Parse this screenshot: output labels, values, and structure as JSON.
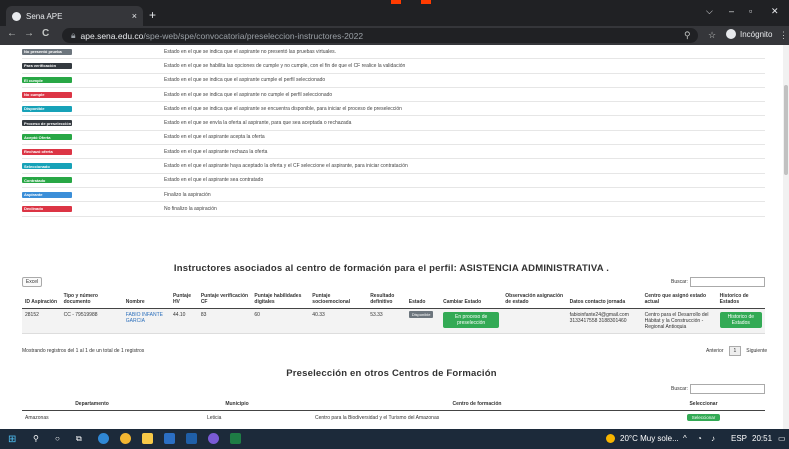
{
  "browser": {
    "tab_title": "Sena APE",
    "tab_close": "×",
    "new_tab": "+",
    "window_controls": {
      "minimize": "⌵",
      "min": "–",
      "max": "▫",
      "close": "✕"
    },
    "nav": {
      "back": "←",
      "forward": "→",
      "reload": "C"
    },
    "url_host": "ape.sena.edu.co",
    "url_path": "/spe-web/spe/convocatoria/preseleccion-instructores-2022",
    "profile_label": "Incógnito"
  },
  "legend": [
    {
      "badge": "No presentó prueba",
      "color": "#6c757d",
      "desc": "Estado en el que se indica que el aspirante no presentó las pruebas virtuales."
    },
    {
      "badge": "Para verificación",
      "color": "#343a40",
      "desc": "Estado en el que se habilita las opciones de cumple y no cumple, con el fin de que el CF realice la validación"
    },
    {
      "badge": "El cumple",
      "color": "#28a745",
      "desc": "Estado en el que se indica que el aspirante cumple el perfil seleccionado"
    },
    {
      "badge": "No cumple",
      "color": "#dc3545",
      "desc": "Estado en el que se indica que el aspirante no cumple el perfil seleccionado"
    },
    {
      "badge": "Disponible",
      "color": "#17a2b8",
      "desc": "Estado en el que se indica que el aspirante se encuentra disponible, para iniciar el proceso de preselección"
    },
    {
      "badge": "Proceso de preselección",
      "color": "#343a40",
      "desc": "Estado en el que se envía la oferta al aspirante, para que sea aceptada o rechazada"
    },
    {
      "badge": "Aceptó Oferta",
      "color": "#28a745",
      "desc": "Estado en el que el aspirante acepta la oferta"
    },
    {
      "badge": "Rechazó oferta",
      "color": "#dc3545",
      "desc": "Estado en el que el aspirante rechaza la oferta"
    },
    {
      "badge": "Seleccionado",
      "color": "#17a2b8",
      "desc": "Estado en el que el aspirante haya aceptado la oferta y el CF seleccione el aspirante, para iniciar contratación"
    },
    {
      "badge": "Contratado",
      "color": "#28a745",
      "desc": "Estado en el que el aspirante sea contratado"
    },
    {
      "badge": "Aspirante",
      "color": "#3b8ed8",
      "desc": "Finalizo la aspiración"
    },
    {
      "badge": "Declinado",
      "color": "#dc3545",
      "desc": "No finalizo la aspiración"
    }
  ],
  "section1": {
    "title": "Instructores asociados al centro de formación para el perfil: ASISTENCIA ADMINISTRATIVA .",
    "excel_label": "Excel",
    "search_label": "Buscar:",
    "columns": [
      "ID Aspiración",
      "Tipo y número documento",
      "Nombre",
      "Puntaje HV",
      "Puntaje verificación CF",
      "Puntaje habilidades digitales",
      "Puntaje socioemocional",
      "Resultado definitivo",
      "Estado",
      "Cambiar Estado",
      "Observación asignación de estado",
      "Datos contacto jornada",
      "Centro que asignó estado actual",
      "Historico de Estados"
    ],
    "row": {
      "id": "28152",
      "doc": "CC - 79519988",
      "name": "FABIO INFANTE GARCIA",
      "hv": "44.10",
      "verif": "83",
      "digital": "60",
      "socio": "40.33",
      "result": "53.33",
      "state": "Disponible",
      "change_state": "En proceso de preselección",
      "observation": "",
      "contact": "fabioinfante24@gmail.com 3133417558 3188301460",
      "center": "Centro para el Desarrollo del Hábitat y la Construcción - Regional Antioquia",
      "history_btn": "Historico de Estados"
    },
    "info": "Mostrando registros del 1 al 1 de un total de 1 registros",
    "pager": {
      "prev": "Anterior",
      "current": "1",
      "next": "Siguiente"
    }
  },
  "section2": {
    "title": "Preselección en otros Centros de Formación",
    "search_label": "Buscar:",
    "columns": [
      "Departamento",
      "Municipio",
      "Centro de formación",
      "Seleccionar"
    ],
    "row": {
      "dept": "Amazonas",
      "municipio": "Leticia",
      "centro": "Centro para la Biodiversidad y el Turismo del Amazonas",
      "select_btn": "Seleccionar"
    }
  },
  "taskbar": {
    "weather": "20°C  Muy sole...",
    "lang": "ESP",
    "time": "20:51"
  }
}
